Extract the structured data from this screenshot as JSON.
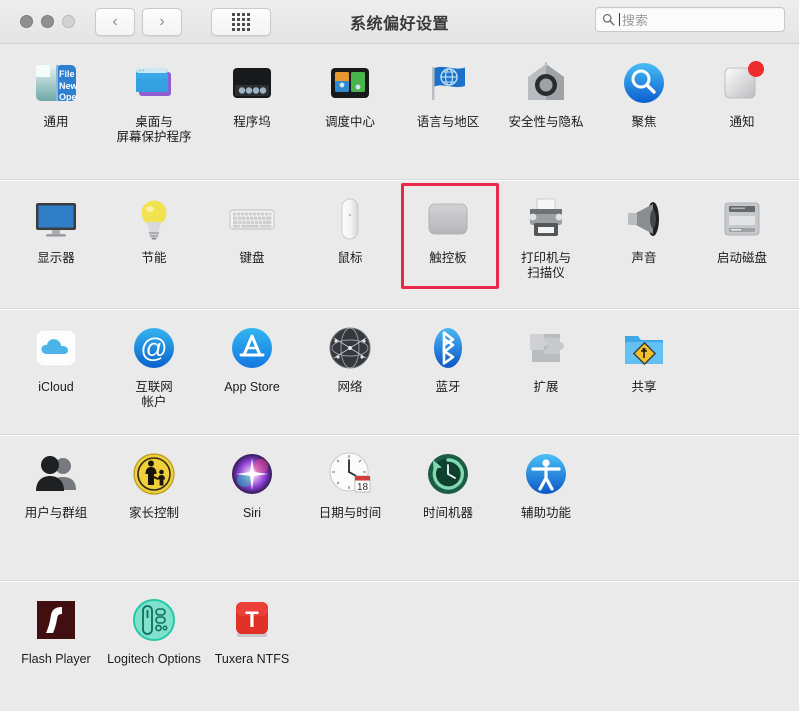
{
  "window": {
    "title": "系统偏好设置",
    "traffic_lights": [
      "close",
      "minimize",
      "zoom"
    ]
  },
  "toolbar": {
    "back_label": "‹",
    "forward_label": "›",
    "grid_label": "show-all-grid",
    "search": {
      "placeholder": "搜索",
      "value": "",
      "icon": "search-icon"
    }
  },
  "highlight": {
    "target": "触控板",
    "color": "#e8294a"
  },
  "sections": [
    {
      "id": "sec-1",
      "items": [
        {
          "label": "通用",
          "icon": "general-icon"
        },
        {
          "label": "桌面与\n屏幕保护程序",
          "icon": "desktop-screensaver-icon"
        },
        {
          "label": "程序坞",
          "icon": "dock-icon"
        },
        {
          "label": "调度中心",
          "icon": "mission-control-icon"
        },
        {
          "label": "语言与地区",
          "icon": "language-region-icon"
        },
        {
          "label": "安全性与隐私",
          "icon": "security-privacy-icon"
        },
        {
          "label": "聚焦",
          "icon": "spotlight-icon"
        },
        {
          "label": "通知",
          "icon": "notifications-icon"
        }
      ]
    },
    {
      "id": "sec-2",
      "items": [
        {
          "label": "显示器",
          "icon": "displays-icon"
        },
        {
          "label": "节能",
          "icon": "energy-saver-icon"
        },
        {
          "label": "键盘",
          "icon": "keyboard-icon"
        },
        {
          "label": "鼠标",
          "icon": "mouse-icon"
        },
        {
          "label": "触控板",
          "icon": "trackpad-icon",
          "highlighted": true
        },
        {
          "label": "打印机与\n扫描仪",
          "icon": "printers-scanners-icon"
        },
        {
          "label": "声音",
          "icon": "sound-icon"
        },
        {
          "label": "启动磁盘",
          "icon": "startup-disk-icon"
        }
      ]
    },
    {
      "id": "sec-3",
      "items": [
        {
          "label": "iCloud",
          "icon": "icloud-icon"
        },
        {
          "label": "互联网\n帐户",
          "icon": "internet-accounts-icon"
        },
        {
          "label": "App Store",
          "icon": "app-store-icon"
        },
        {
          "label": "网络",
          "icon": "network-icon"
        },
        {
          "label": "蓝牙",
          "icon": "bluetooth-icon"
        },
        {
          "label": "扩展",
          "icon": "extensions-icon"
        },
        {
          "label": "共享",
          "icon": "sharing-icon"
        }
      ]
    },
    {
      "id": "sec-4",
      "items": [
        {
          "label": "用户与群组",
          "icon": "users-groups-icon"
        },
        {
          "label": "家长控制",
          "icon": "parental-controls-icon"
        },
        {
          "label": "Siri",
          "icon": "siri-icon"
        },
        {
          "label": "日期与时间",
          "icon": "date-time-icon"
        },
        {
          "label": "时间机器",
          "icon": "time-machine-icon"
        },
        {
          "label": "辅助功能",
          "icon": "accessibility-icon"
        }
      ]
    },
    {
      "id": "sec-5",
      "items": [
        {
          "label": "Flash Player",
          "icon": "flash-player-icon"
        },
        {
          "label": "Logitech Options",
          "icon": "logitech-options-icon"
        },
        {
          "label": "Tuxera NTFS",
          "icon": "tuxera-ntfs-icon"
        }
      ]
    }
  ]
}
